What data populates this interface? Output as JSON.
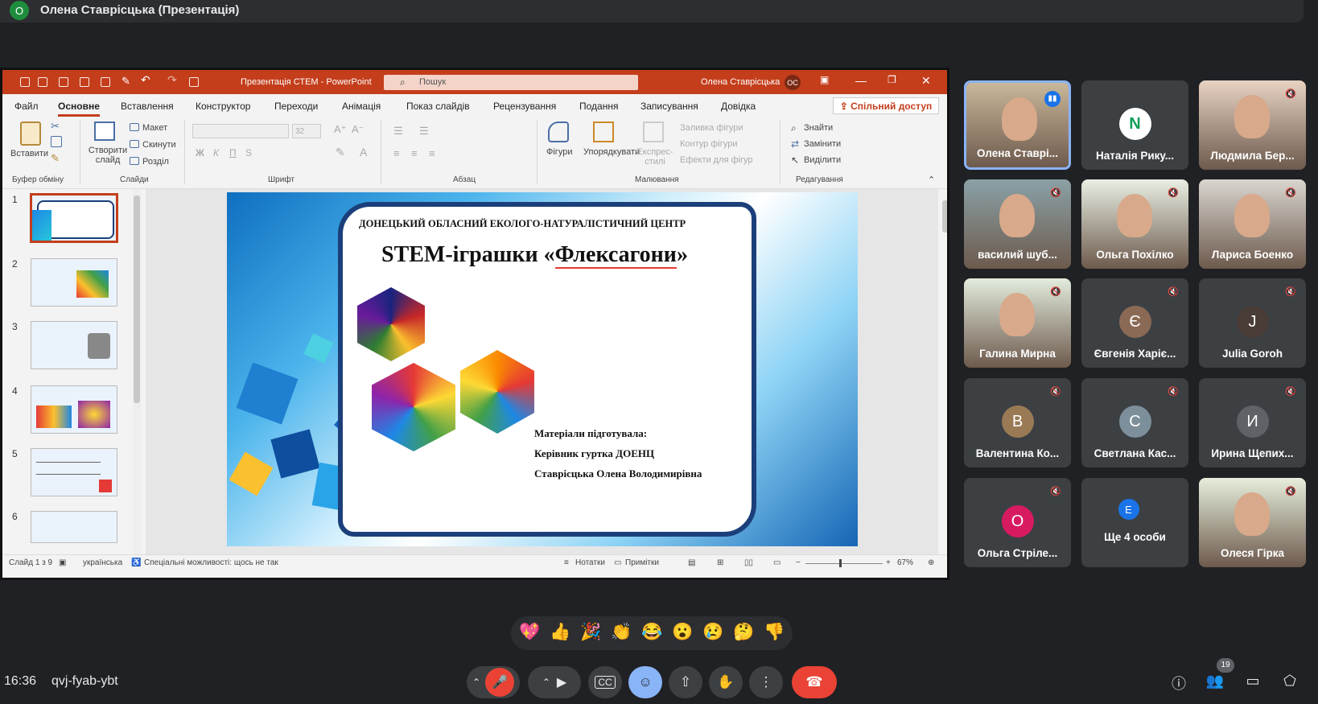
{
  "presenter": {
    "initial": "О",
    "label": "Олена Ставрісцька (Презентація)"
  },
  "ppt": {
    "doc_title": "Презентація СТЕМ  -  PowerPoint",
    "search_placeholder": "Пошук",
    "user_name": "Олена Ставрісцька",
    "user_initials": "ОС",
    "tabs": [
      "Файл",
      "Основне",
      "Вставлення",
      "Конструктор",
      "Переходи",
      "Анімація",
      "Показ слайдів",
      "Рецензування",
      "Подання",
      "Записування",
      "Довідка"
    ],
    "share": "Спільний доступ",
    "ribbon": {
      "paste": "Вставити",
      "clipboard": "Буфер обміну",
      "new_slide": "Створити слайд",
      "layout": "Макет",
      "reset": "Скинути",
      "section": "Розділ",
      "slides": "Слайди",
      "font_size": "32",
      "font": "Шрифт",
      "paragraph": "Абзац",
      "shapes": "Фігури",
      "arrange": "Упорядкувати",
      "quick_styles": "Експрес-стилі",
      "fill": "Заливка фігури",
      "outline": "Контур фігури",
      "effects": "Ефекти для фігур",
      "drawing": "Малювання",
      "find": "Знайти",
      "replace": "Замінити",
      "select": "Виділити",
      "editing": "Редагування"
    },
    "thumbnails": [
      "1",
      "2",
      "3",
      "4",
      "5",
      "6"
    ],
    "slide": {
      "org": "ДОНЕЦЬКИЙ ОБЛАСНИЙ ЕКОЛОГО-НАТУРАЛІСТИЧНИЙ ЦЕНТР",
      "title_pre": "STEM-іграшки «",
      "title_word": "Флексагони",
      "title_post": "»",
      "prepared": "Матеріали підготувала:",
      "role": "Керівник гуртка ДОЕНЦ",
      "author": "Ставрісцька Олена Володимирівна"
    },
    "status": {
      "slide": "Слайд 1 з 9",
      "lang": "українська",
      "access": "Спеціальні можливості: щось не так",
      "notes": "Нотатки",
      "comments": "Примітки",
      "zoom": "67%"
    }
  },
  "participants": [
    {
      "name": "Олена Ставрі...",
      "type": "photo",
      "speaking": true,
      "bg": "#c9b79a"
    },
    {
      "name": "Наталія Рику...",
      "type": "avatar",
      "initial": "N",
      "color": "#ffffff"
    },
    {
      "name": "Людмила Бер...",
      "type": "photo",
      "muted": true,
      "bg": "#e8d3c3"
    },
    {
      "name": "василий шуб...",
      "type": "photo",
      "muted": true,
      "bg": "#8aa1a6"
    },
    {
      "name": "Ольга Похілко",
      "type": "photo",
      "muted": true,
      "bg": "#e9efe3"
    },
    {
      "name": "Лариса Боенко",
      "type": "photo",
      "muted": true,
      "bg": "#d9d6cf"
    },
    {
      "name": "Галина Мирна",
      "type": "photo",
      "muted": true,
      "bg": "#e3ecdd"
    },
    {
      "name": "Євгенія Харіє...",
      "type": "avatar",
      "initial": "Є",
      "color": "#8a6a55",
      "muted": true
    },
    {
      "name": "Julia Goroh",
      "type": "avatar",
      "initial": "J",
      "color": "#4a3c36",
      "muted": true
    },
    {
      "name": "Валентина Ко...",
      "type": "avatar",
      "initial": "В",
      "color": "#9a7a55",
      "muted": true
    },
    {
      "name": "Светлана Кас...",
      "type": "avatar",
      "initial": "С",
      "color": "#7d8f9b",
      "muted": true
    },
    {
      "name": "Ирина Щепих...",
      "type": "avatar",
      "initial": "И",
      "color": "#5f6368",
      "muted": true
    },
    {
      "name": "Ольга Стріле...",
      "type": "avatar",
      "initial": "О",
      "color": "#d81b60",
      "muted": true
    },
    {
      "name": "Ще 4 особи",
      "type": "more",
      "initial": "Е",
      "color": "#1a73e8"
    },
    {
      "name": "Олеся Гірка",
      "type": "photo",
      "muted": true,
      "bg": "#e6eedc"
    }
  ],
  "reactions": [
    "💖",
    "👍",
    "🎉",
    "👏",
    "😂",
    "😮",
    "😢",
    "🤔",
    "👎"
  ],
  "bottom": {
    "time": "16:36",
    "code": "qvj-fyab-ybt",
    "people_count": "19"
  }
}
